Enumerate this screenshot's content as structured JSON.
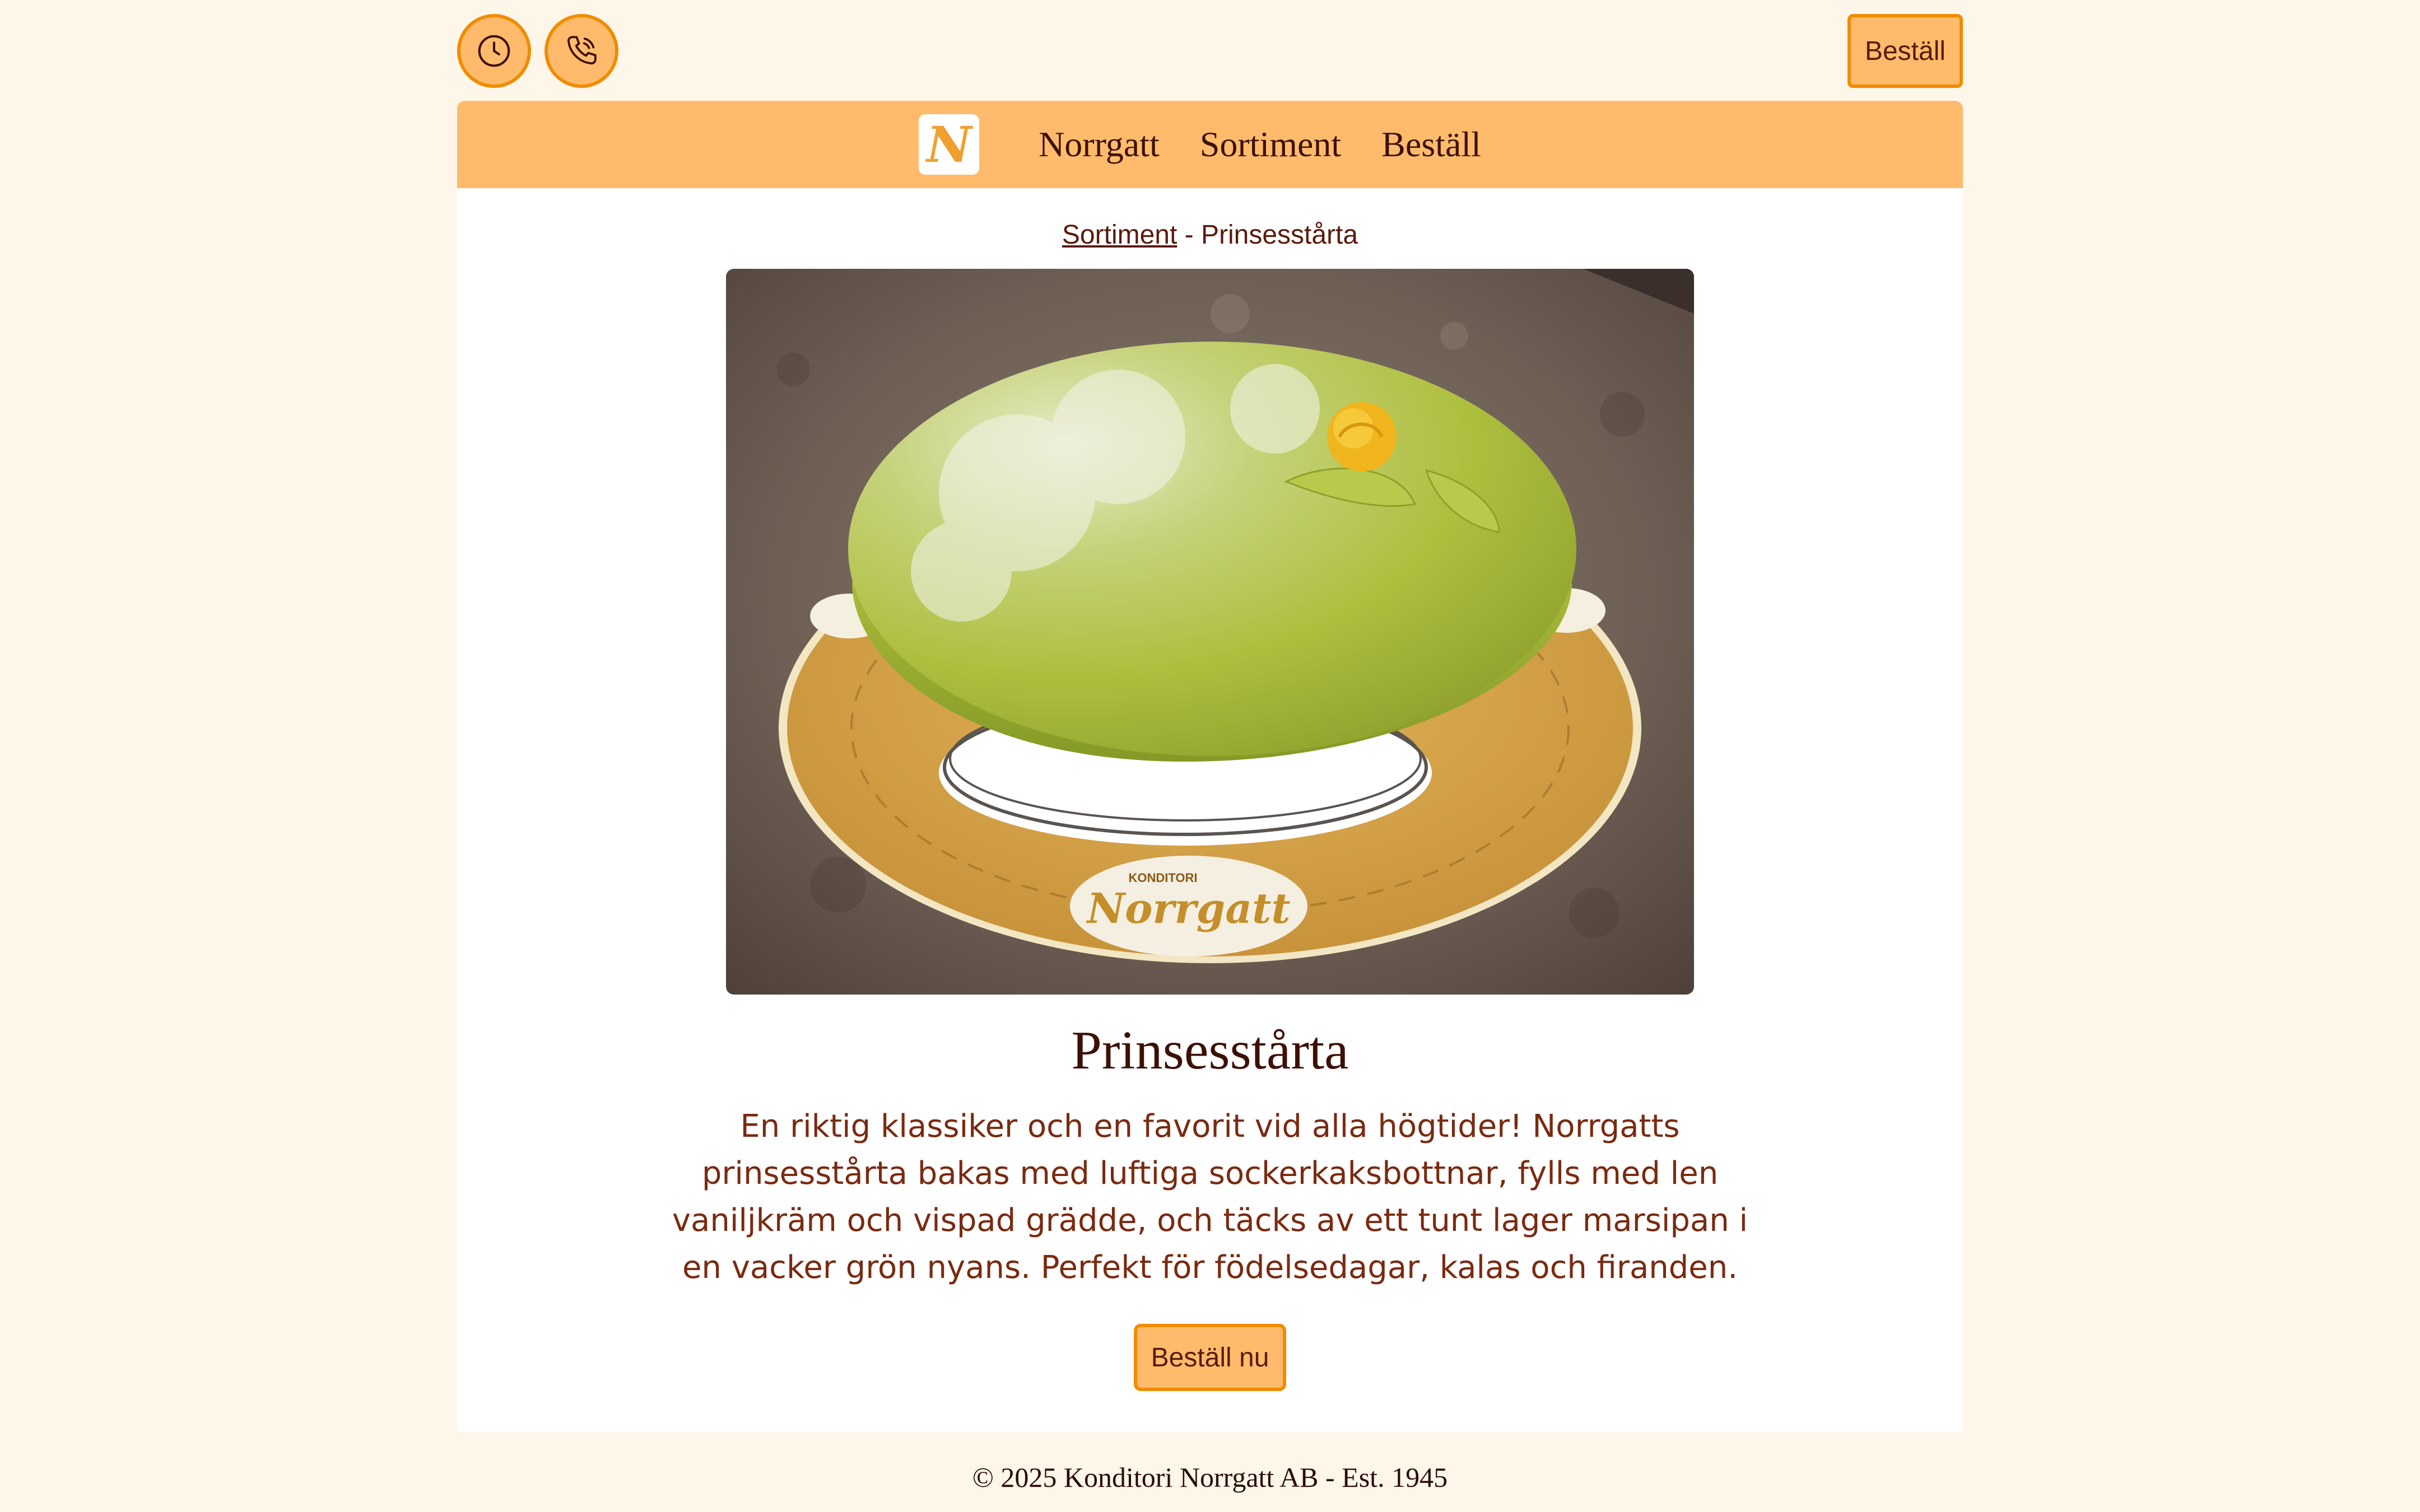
{
  "top_bar": {
    "clock_icon": "clock-icon",
    "phone_icon": "phone-icon",
    "order_label": "Beställ"
  },
  "nav": {
    "logo_letter": "N",
    "links": [
      {
        "label": "Norrgatt"
      },
      {
        "label": "Sortiment"
      },
      {
        "label": "Beställ"
      }
    ]
  },
  "breadcrumb": {
    "parent": "Sortiment",
    "separator": " - ",
    "current": "Prinsesstårta"
  },
  "product": {
    "plate_brand": "Norrgatt",
    "plate_top": "KONDITORI",
    "title": "Prinsesstårta",
    "description": "En riktig klassiker och en favorit vid alla högtider! Norrgatts prinsesstårta bakas med luftiga sockerkaksbottnar, fylls med len vaniljkräm och vispad grädde, och täcks av ett tunt lager marsipan i en vacker grön nyans. Perfekt för födelsedagar, kalas och firanden.",
    "order_button": "Beställ nu"
  },
  "footer": {
    "copyright": "© 2025 Konditori Norrgatt AB - Est. 1945"
  },
  "colors": {
    "page_bg": "#fff6ea",
    "accent": "#ffbb6b",
    "accent_border": "#f08c00",
    "text": "#5a1a0b"
  }
}
